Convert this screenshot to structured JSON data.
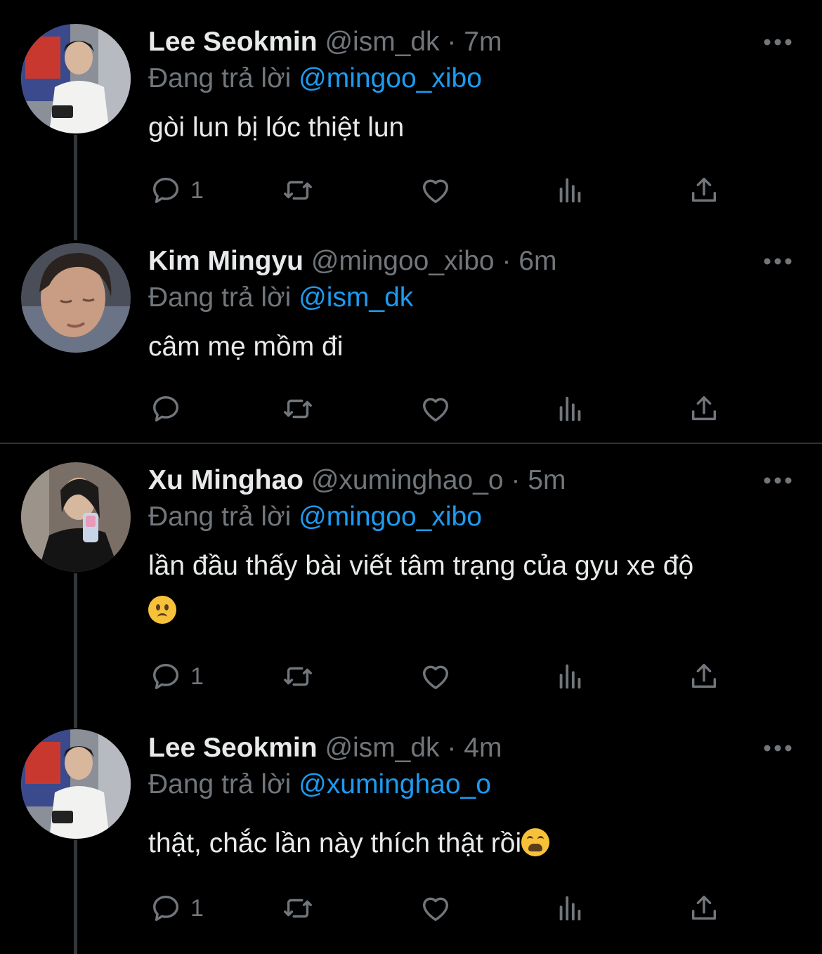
{
  "tweets": [
    {
      "name": "Lee Seokmin",
      "handle": "@ism_dk",
      "sep": "·",
      "time": "7m",
      "reply_prefix": "Đang trả lời",
      "reply_to": "@mingoo_xibo",
      "text": "gòi lun bị lóc thiệt lun",
      "reply_count": "1"
    },
    {
      "name": "Kim Mingyu",
      "handle": "@mingoo_xibo",
      "sep": "·",
      "time": "6m",
      "reply_prefix": "Đang trả lời",
      "reply_to": "@ism_dk",
      "text": "câm mẹ mồm đi",
      "reply_count": ""
    },
    {
      "name": "Xu Minghao",
      "handle": "@xuminghao_o",
      "sep": "·",
      "time": "5m",
      "reply_prefix": "Đang trả lời",
      "reply_to": "@mingoo_xibo",
      "text": "lần đầu thấy bài viết tâm trạng của gyu xe độ",
      "emoji": "worried-face-emoji",
      "reply_count": "1"
    },
    {
      "name": "Lee Seokmin",
      "handle": "@ism_dk",
      "sep": "·",
      "time": "4m",
      "reply_prefix": "Đang trả lời",
      "reply_to": "@xuminghao_o",
      "text": "thật, chắc lần này thích thật rồi",
      "emoji": "weary-face-emoji",
      "reply_count": "1"
    }
  ],
  "icons": [
    "reply-icon",
    "retweet-icon",
    "like-icon",
    "views-icon",
    "share-icon",
    "more-icon"
  ],
  "colors": {
    "background": "#000000",
    "mention": "#1d9bf0",
    "muted": "#71767b",
    "text": "#e7e9ea"
  }
}
